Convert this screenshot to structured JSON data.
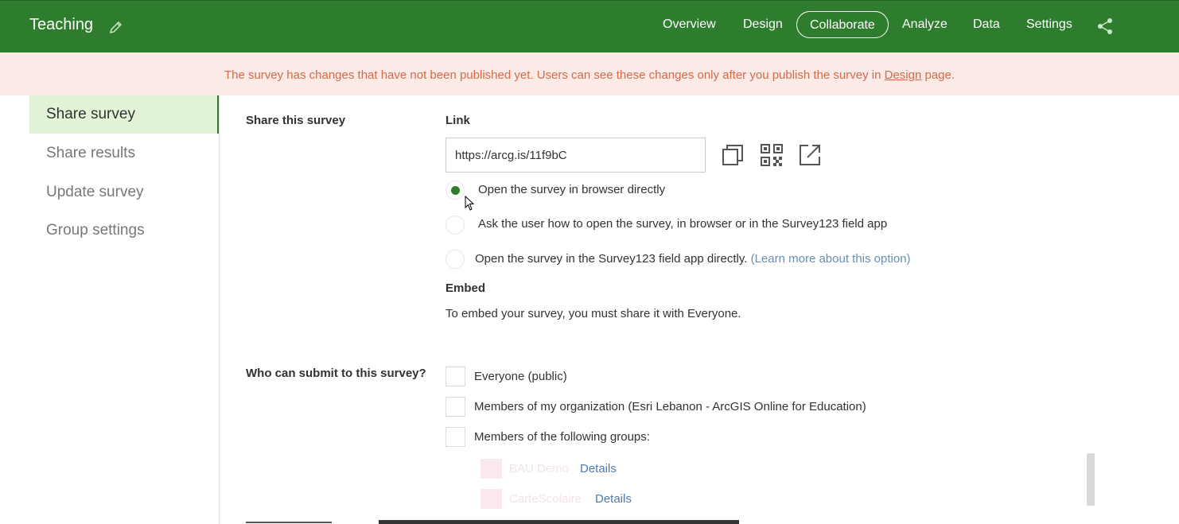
{
  "header": {
    "title": "Teaching",
    "nav": [
      "Overview",
      "Design",
      "Collaborate",
      "Analyze",
      "Data",
      "Settings"
    ],
    "active_nav": "Collaborate",
    "accent": "#2e7d2e"
  },
  "banner": {
    "text_before": "The survey has changes that have not been published yet. Users can see these changes only after you publish the survey in ",
    "link": "Design",
    "text_after": " page."
  },
  "sidebar": {
    "items": [
      {
        "label": "Share survey"
      },
      {
        "label": "Share results"
      },
      {
        "label": "Update survey"
      },
      {
        "label": "Group settings"
      }
    ],
    "active": "Share survey"
  },
  "share": {
    "section_label": "Share this survey",
    "link_label": "Link",
    "link_value": "https://arcg.is/11f9bC",
    "options": [
      {
        "label": "Open the survey in browser directly",
        "checked": true
      },
      {
        "label": "Ask the user how to open the survey, in browser or in the Survey123 field app",
        "checked": false
      },
      {
        "label": "Open the survey in the Survey123 field app directly.",
        "checked": false
      }
    ],
    "learn_more": "(Learn more about this option)",
    "embed_label": "Embed",
    "embed_text": "To embed your survey, you must share it with Everyone."
  },
  "submit": {
    "section_label": "Who can submit to this survey?",
    "options": [
      {
        "label": "Everyone (public)"
      },
      {
        "label": "Members of my organization (Esri Lebanon - ArcGIS Online for Education)"
      },
      {
        "label": "Members of the following groups:"
      }
    ],
    "groups": [
      {
        "name": "BAU Demo",
        "details": "Details"
      },
      {
        "name": "CarteScolaire",
        "details": "Details"
      }
    ]
  }
}
